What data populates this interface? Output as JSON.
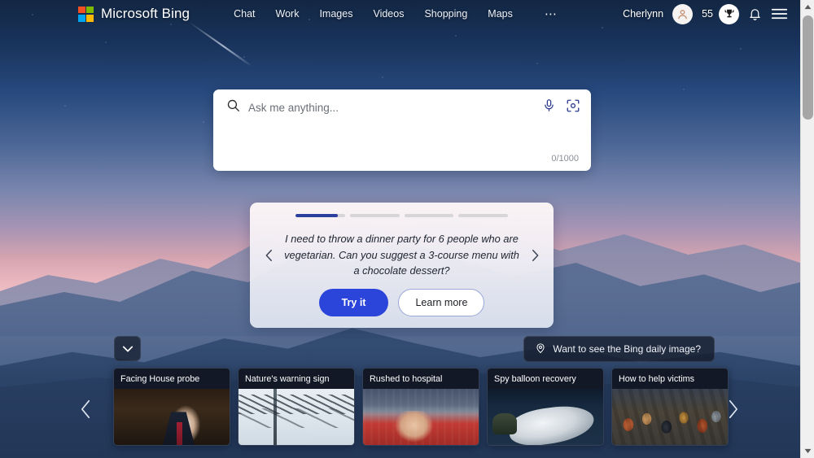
{
  "header": {
    "brand": "Microsoft Bing",
    "logo_icon": "microsoft-logo",
    "logo_colors": [
      "#f25022",
      "#7fba00",
      "#00a4ef",
      "#ffb900"
    ],
    "nav": [
      {
        "label": "Chat",
        "name": "chat"
      },
      {
        "label": "Work",
        "name": "work"
      },
      {
        "label": "Images",
        "name": "images"
      },
      {
        "label": "Videos",
        "name": "videos"
      },
      {
        "label": "Shopping",
        "name": "shopping"
      },
      {
        "label": "Maps",
        "name": "maps"
      }
    ],
    "more_label": "⋯",
    "user_name": "Cherlynn",
    "avatar_icon": "user-avatar-icon",
    "rewards_count": "55",
    "rewards_icon": "trophy-icon",
    "notifications_icon": "bell-icon",
    "menu_icon": "hamburger-menu-icon"
  },
  "search": {
    "placeholder": "Ask me anything...",
    "value": "",
    "counter": "0/1000",
    "search_icon": "search-icon",
    "mic_icon": "microphone-icon",
    "visual_icon": "visual-search-icon"
  },
  "suggestion": {
    "prompt": "I need to throw a dinner party for 6 people who are vegetarian. Can you suggest a 3-course menu with a chocolate dessert?",
    "try_label": "Try it",
    "learn_label": "Learn more",
    "prev_icon": "chevron-left-icon",
    "next_icon": "chevron-right-icon",
    "segments": 4,
    "active_segment": 0,
    "active_fill_color": "#2b3f9e",
    "primary_color": "#2b44d9"
  },
  "daily_image": {
    "label": "Want to see the Bing daily image?",
    "icon": "location-pin-icon"
  },
  "collapse": {
    "icon": "chevron-down-icon"
  },
  "news": {
    "cards": [
      {
        "title": "Facing House probe",
        "art": "img-hearing"
      },
      {
        "title": "Nature's warning sign",
        "art": "img-wires"
      },
      {
        "title": "Rushed to hospital",
        "art": "img-fan"
      },
      {
        "title": "Spy balloon recovery",
        "art": "img-balloon"
      },
      {
        "title": "How to help victims",
        "art": "img-crowd"
      }
    ],
    "prev_icon": "chevron-left-icon",
    "next_icon": "chevron-right-icon"
  },
  "scrollbar": {
    "up_icon": "scroll-up-arrow-icon",
    "down_icon": "scroll-down-arrow-icon"
  }
}
